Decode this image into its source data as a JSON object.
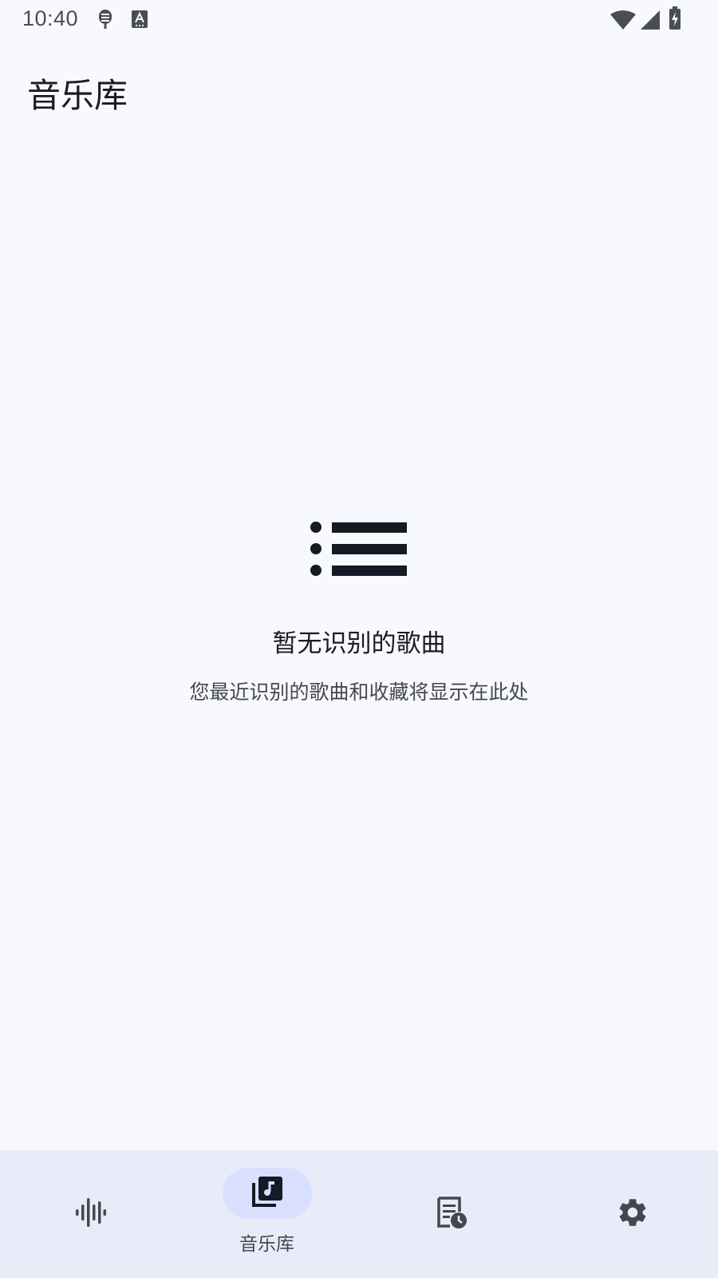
{
  "status_bar": {
    "time": "10:40",
    "icons": [
      "podcast-mic-icon",
      "keyboard-a-icon",
      "wifi-icon",
      "cell-signal-icon",
      "battery-charging-icon"
    ]
  },
  "header": {
    "title": "音乐库"
  },
  "empty_state": {
    "icon": "list-icon",
    "title": "暂无识别的歌曲",
    "subtitle": "您最近识别的歌曲和收藏将显示在此处"
  },
  "bottom_nav": {
    "items": [
      {
        "icon": "waveform-icon",
        "label": "",
        "active": false
      },
      {
        "icon": "music-library-icon",
        "label": "音乐库",
        "active": true
      },
      {
        "icon": "history-list-icon",
        "label": "",
        "active": false
      },
      {
        "icon": "settings-gear-icon",
        "label": "",
        "active": false
      }
    ]
  },
  "colors": {
    "background": "#f8f9ff",
    "nav_background": "#e9ecf8",
    "active_pill": "#d9e0ff",
    "text_primary": "#1a1c22",
    "text_secondary": "#454850"
  }
}
